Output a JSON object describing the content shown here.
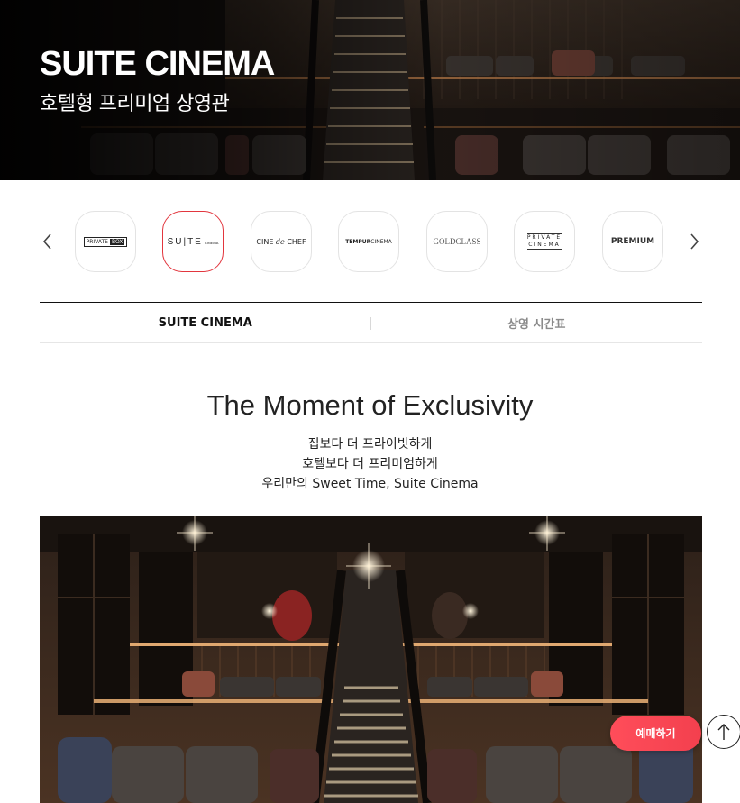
{
  "hero": {
    "title": "SUITE CINEMA",
    "subtitle": "호텔형 프리미엄 상영관"
  },
  "brands": {
    "prev_icon": "chevron-left-icon",
    "next_icon": "chevron-right-icon",
    "items": [
      {
        "id": "private-box",
        "label": "PRIVATE BOX",
        "active": false
      },
      {
        "id": "suite-cinema",
        "label": "SUITE CINEMA",
        "active": true
      },
      {
        "id": "cine-de-chef",
        "label": "CINE de CHEF",
        "active": false
      },
      {
        "id": "tempur-cinema",
        "label": "TEMPUR CINEMA",
        "active": false
      },
      {
        "id": "goldclass",
        "label": "GOLDCLASS",
        "active": false
      },
      {
        "id": "private-cinema",
        "label": "PRIVATE CINEMA",
        "active": false
      },
      {
        "id": "premium",
        "label": "PREMIUM",
        "active": false
      }
    ]
  },
  "tabs": [
    {
      "label": "SUITE CINEMA",
      "active": true
    },
    {
      "label": "상영 시간표",
      "active": false
    }
  ],
  "intro": {
    "title": "The Moment of Exclusivity",
    "lines": [
      "집보다 더 프라이빗하게",
      "호텔보다 더 프리미엄하게",
      "우리만의 Sweet Time, Suite Cinema"
    ]
  },
  "floating": {
    "reserve_label": "예매하기",
    "top_icon": "arrow-up-icon"
  },
  "colors": {
    "accent": "#e2363e",
    "reserve": "#f3404e"
  }
}
